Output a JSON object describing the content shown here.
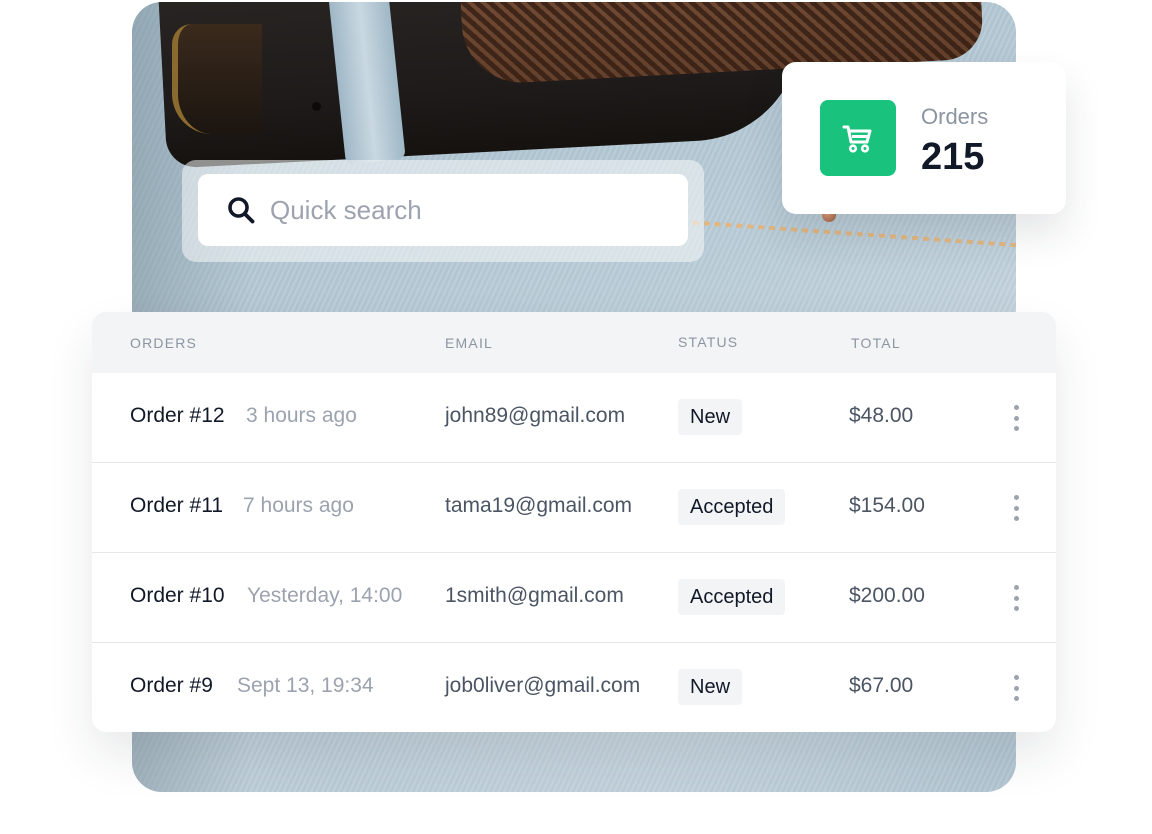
{
  "search": {
    "placeholder": "Quick search"
  },
  "stat": {
    "label": "Orders",
    "value": "215",
    "accent": "#19c37d",
    "icon": "shopping-cart-icon"
  },
  "table": {
    "columns": [
      "ORDERS",
      "EMAIL",
      "STATUS",
      "TOTAL"
    ],
    "rows": [
      {
        "order": "Order #12",
        "time": "3 hours ago",
        "email": "john89@gmail.com",
        "status": "New",
        "total": "$48.00"
      },
      {
        "order": "Order #11",
        "time": "7 hours ago",
        "email": "tama19@gmail.com",
        "status": "Accepted",
        "total": "$154.00"
      },
      {
        "order": "Order #10",
        "time": "Yesterday, 14:00",
        "email": "1smith@gmail.com",
        "status": "Accepted",
        "total": "$200.00"
      },
      {
        "order": "Order #9",
        "time": "Sept 13, 19:34",
        "email": "job0liver@gmail.com",
        "status": "New",
        "total": "$67.00"
      }
    ],
    "row_menu_icon": "more-vertical-icon"
  }
}
